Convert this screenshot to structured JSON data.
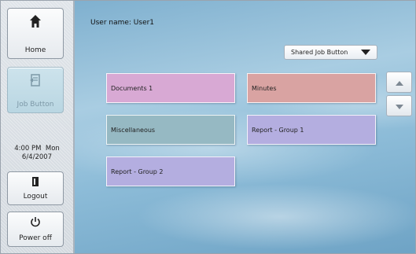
{
  "sidebar": {
    "home_label": "Home",
    "job_button_label": "Job Button",
    "clock_time": "4:00 PM  Mon",
    "clock_date": "6/4/2007",
    "logout_label": "Logout",
    "power_label": "Power off"
  },
  "main": {
    "user_line": "User name: User1",
    "shared_job_button_label": "Shared Job Button",
    "jobs": [
      {
        "label": "Documents 1",
        "color": "#d8a9d4"
      },
      {
        "label": "Minutes",
        "color": "#d9a3a2"
      },
      {
        "label": "Miscellaneous",
        "color": "#96b9c3"
      },
      {
        "label": "Report - Group 1",
        "color": "#b4aee0"
      },
      {
        "label": "Report - Group 2",
        "color": "#b4aee0"
      }
    ]
  },
  "icons": {
    "home": "home-icon",
    "job": "job-button-icon",
    "logout": "logout-icon",
    "power": "power-icon",
    "scroll_up": "scroll-up-icon",
    "scroll_down": "scroll-down-icon",
    "dropdown": "chevron-down-icon"
  }
}
